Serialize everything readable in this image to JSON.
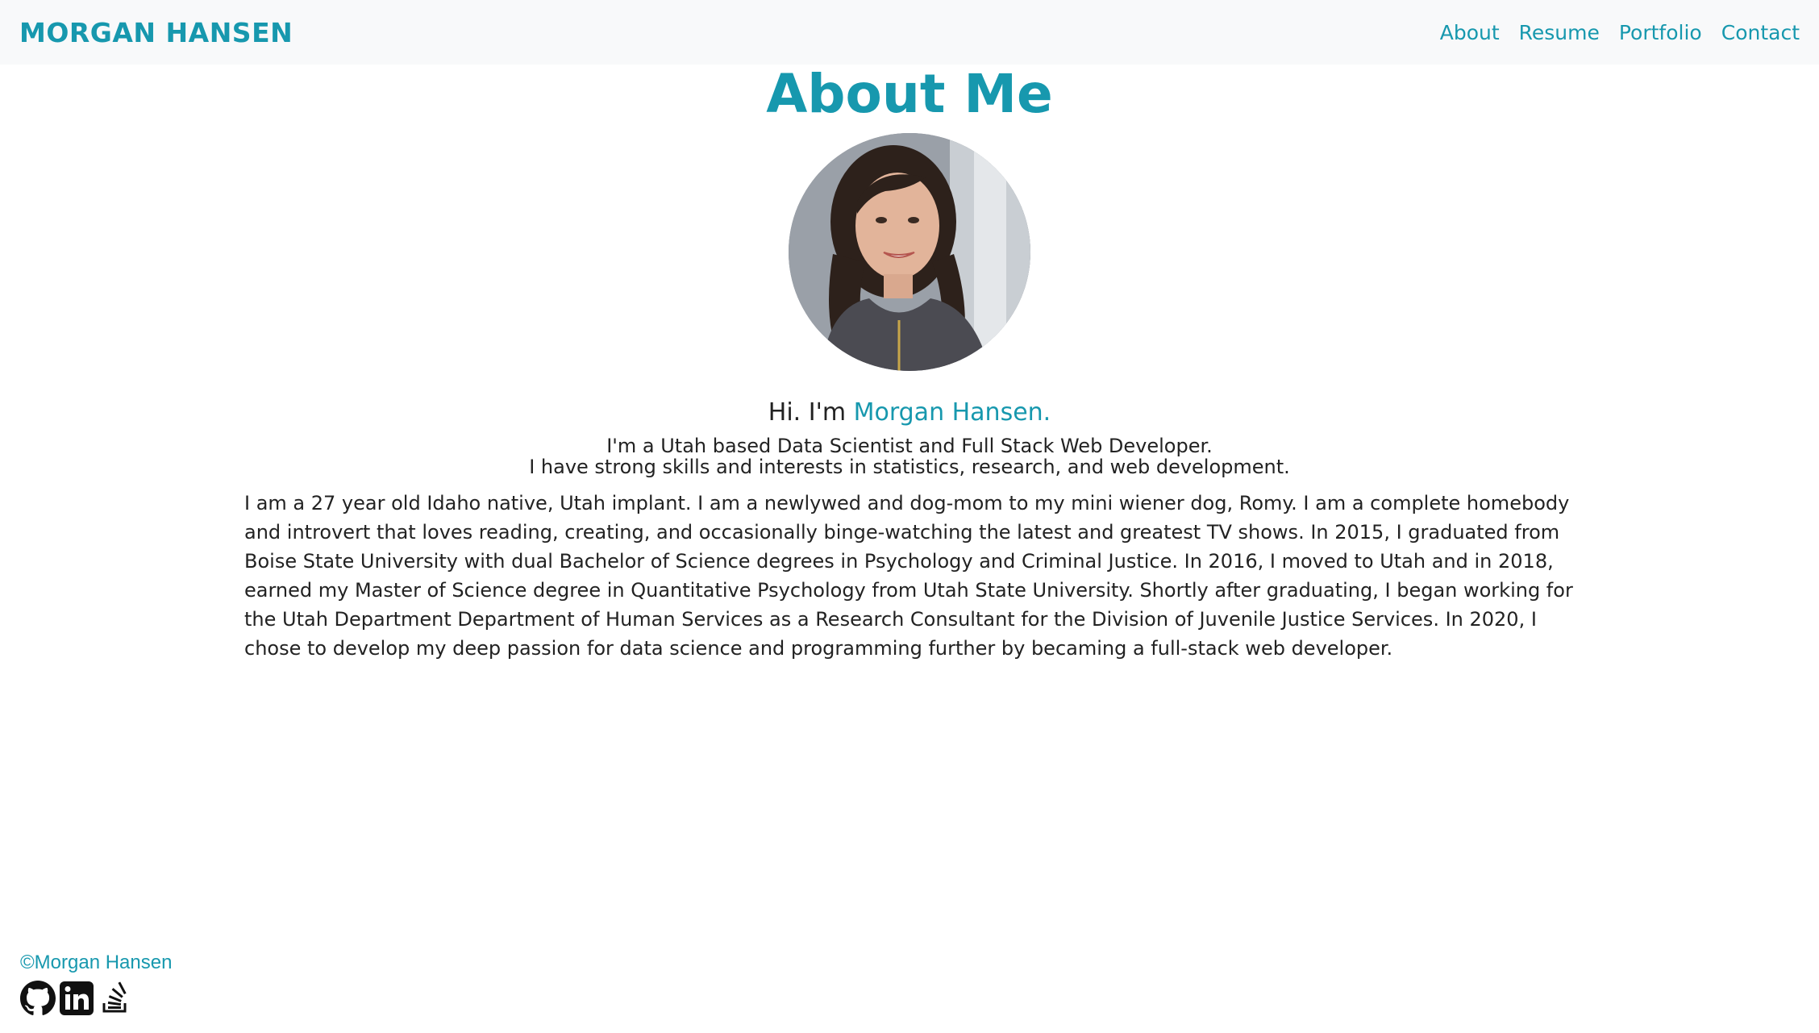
{
  "header": {
    "brand": "MORGAN HANSEN",
    "nav": [
      {
        "label": "About"
      },
      {
        "label": "Resume"
      },
      {
        "label": "Portfolio"
      },
      {
        "label": "Contact"
      }
    ]
  },
  "main": {
    "heading": "About Me",
    "greeting_prefix": "Hi. I'm ",
    "greeting_name": "Morgan Hansen.",
    "tagline_line1": "I'm a Utah based Data Scientist and Full Stack Web Developer.",
    "tagline_line2": "I have strong skills and interests in statistics, research, and web development.",
    "bio": "I am a 27 year old Idaho native, Utah implant. I am a newlywed and dog-mom to my mini wiener dog, Romy. I am a complete homebody and introvert that loves reading, creating, and occasionally binge-watching the latest and greatest TV shows. In 2015, I graduated from Boise State University with dual Bachelor of Science degrees in Psychology and Criminal Justice. In 2016, I moved to Utah and in 2018, earned my Master of Science degree in Quantitative Psychology from Utah State University. Shortly after graduating, I began working for the Utah Department Department of Human Services as a Research Consultant for the Division of Juvenile Justice Services. In 2020, I chose to develop my deep passion for data science and programming further by becaming a full-stack web developer."
  },
  "footer": {
    "copyright": "©Morgan Hansen",
    "social": [
      {
        "icon": "github-icon"
      },
      {
        "icon": "linkedin-icon"
      },
      {
        "icon": "stackoverflow-icon"
      }
    ]
  },
  "colors": {
    "accent": "#1798ae",
    "navbar_bg": "#f8f9fa",
    "text": "#222222"
  }
}
